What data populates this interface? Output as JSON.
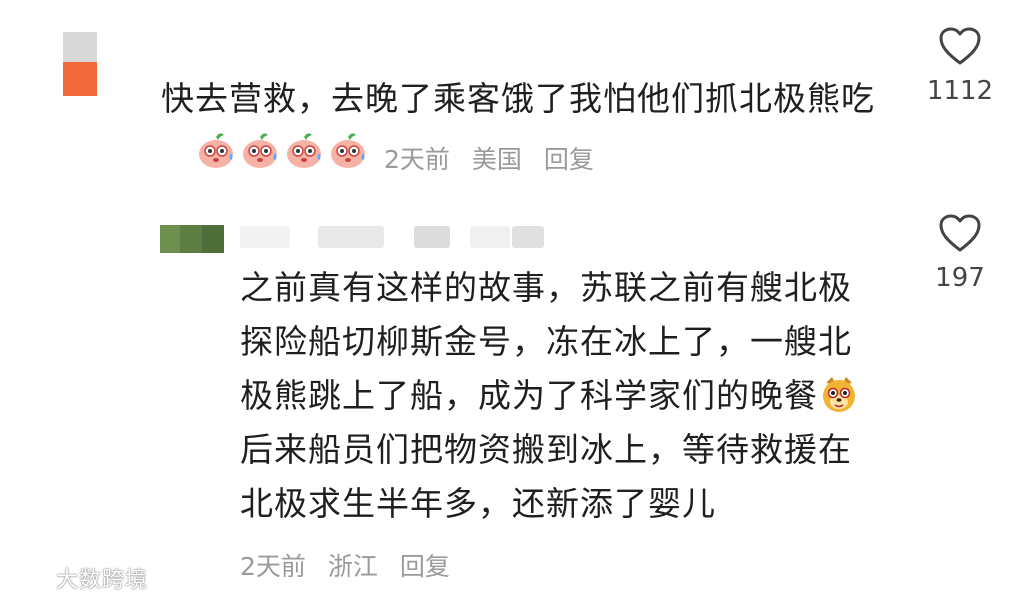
{
  "comments": [
    {
      "text": "快去营救，去晚了乘客饿了我怕他们抓北极熊吃",
      "emoji_name": "sweating-face-emoji",
      "emoji_count": 4,
      "time": "2天前",
      "location": "美国",
      "reply_label": "回复",
      "likes": "1112",
      "avatar_colors": [
        "#d9d9d9",
        "#f06a3c"
      ]
    },
    {
      "text_lines": [
        "之前真有这样的故事，苏联之前有艘北极",
        "探险船切柳斯金号，冻在冰上了，一艘北",
        "极熊跳上了船，成为了科学家们的晚餐",
        "后来船员们把物资搬到冰上，等待救援在",
        "北极求生半年多，还新添了婴儿"
      ],
      "emoji_name": "dog-face-emoji",
      "time": "2天前",
      "location": "浙江",
      "reply_label": "回复",
      "likes": "197",
      "avatar_colors": [
        "#6f8f4e",
        "#4f6e3a"
      ]
    }
  ],
  "watermark": "大数跨境",
  "colors": {
    "text": "#1f1f1f",
    "meta": "#9a9a9a",
    "count": "#444444"
  }
}
